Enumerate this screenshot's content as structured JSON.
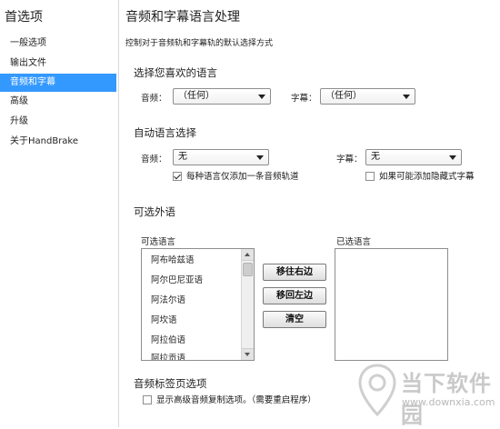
{
  "sidebar": {
    "title": "首选项",
    "items": [
      {
        "label": "一般选项",
        "selected": false
      },
      {
        "label": "输出文件",
        "selected": false
      },
      {
        "label": "音频和字幕",
        "selected": true
      },
      {
        "label": "高级",
        "selected": false
      },
      {
        "label": "升级",
        "selected": false
      },
      {
        "label": "关于HandBrake",
        "selected": false
      }
    ]
  },
  "main": {
    "title": "音频和字幕语言处理",
    "description": "控制对于音频轨和字幕轨的默认选择方式"
  },
  "preferred_language": {
    "title": "选择您喜欢的语言",
    "audio_label": "音频：",
    "audio_value": "（任何）",
    "subtitle_label": "字幕：",
    "subtitle_value": "（任何）"
  },
  "auto_select": {
    "title": "自动语言选择",
    "audio_label": "音频：",
    "audio_value": "无",
    "subtitle_label": "字幕：",
    "subtitle_value": "无",
    "audio_checkbox_label": "每种语言仅添加一条音频轨道",
    "audio_checkbox_checked": true,
    "subtitle_checkbox_label": "如果可能添加隐藏式字幕",
    "subtitle_checkbox_checked": false
  },
  "alt_languages": {
    "title": "可选外语",
    "available_label": "可选语言",
    "selected_label": "已选语言",
    "available": [
      "阿布哈兹语",
      "阿尔巴尼亚语",
      "阿法尔语",
      "阿坎语",
      "阿拉伯语",
      "阿拉贡语"
    ],
    "selected": [],
    "move_right_label": "移往右边",
    "move_left_label": "移回左边",
    "clear_label": "清空"
  },
  "audio_tab": {
    "title": "音频标签页选项",
    "checkbox_label": "显示高级音频复制选项。（需要重启程序）",
    "checkbox_checked": false
  },
  "watermark": {
    "brand": "当下软件园",
    "url": "www.downxia.com"
  }
}
